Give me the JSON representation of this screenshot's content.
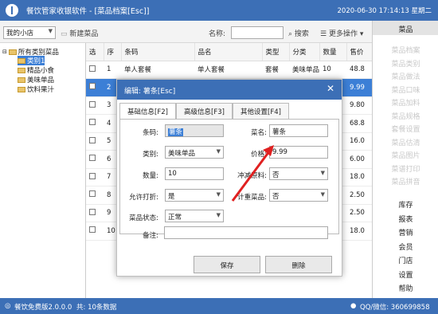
{
  "title": {
    "text": "餐饮管家收银软件 - [菜品档案[Esc]]",
    "datetime": "2020-06-30 17:14:13 星期二"
  },
  "toolbar": {
    "store": "我的小店",
    "add": "新建菜品",
    "name_label": "名称:",
    "search": "搜索",
    "more": "更多操作"
  },
  "tree": {
    "root": "所有类别菜品",
    "items": [
      "类别1",
      "精品小食",
      "美味单品",
      "饮料果汁"
    ]
  },
  "grid": {
    "headers": [
      "选",
      "序",
      "条码",
      "品名",
      "类型",
      "分类",
      "数量",
      "售价"
    ],
    "rows": [
      [
        "",
        "1",
        "单人套餐",
        "单人套餐",
        "套餐",
        "美味单品",
        "10",
        "48.8"
      ],
      [
        "",
        "2",
        "",
        "",
        "",
        "",
        "",
        "9.99"
      ],
      [
        "",
        "3",
        "",
        "",
        "",
        "",
        "",
        "9.80"
      ],
      [
        "",
        "4",
        "",
        "",
        "",
        "",
        "",
        "68.8"
      ],
      [
        "",
        "5",
        "",
        "",
        "",
        "",
        "",
        "16.0"
      ],
      [
        "",
        "6",
        "",
        "",
        "",
        "",
        "",
        "6.00"
      ],
      [
        "",
        "7",
        "",
        "",
        "",
        "",
        "",
        "18.0"
      ],
      [
        "",
        "8",
        "",
        "",
        "",
        "",
        "",
        "2.50"
      ],
      [
        "",
        "9",
        "",
        "",
        "",
        "",
        "",
        "2.50"
      ],
      [
        "",
        "10",
        "",
        "",
        "",
        "",
        "",
        "18.0"
      ]
    ]
  },
  "rightnav": {
    "top": "菜品",
    "faded": [
      "菜品档案",
      "菜品类别",
      "菜品做法",
      "菜品口味",
      "菜品加料",
      "菜品规格",
      "套餐设置",
      "菜品估清",
      "菜品图片",
      "菜谱打印",
      "菜品拼音"
    ],
    "items": [
      "库存",
      "报表",
      "营销",
      "会员",
      "门店",
      "设置",
      "帮助"
    ]
  },
  "status": {
    "version": "餐饮免费版2.0.0.0",
    "count": "共:  10条数据",
    "contact": "QQ/微信: 360699858"
  },
  "dialog": {
    "title": "编辑: 薯条[Esc]",
    "close": "✕",
    "tabs": [
      "基础信息[F2]",
      "高级信息[F3]",
      "其他设置[F4]"
    ],
    "fields": {
      "barcode_label": "条码:",
      "barcode": "薯条",
      "name_label": "菜名:",
      "name": "薯条",
      "category_label": "类别:",
      "category": "美味单品",
      "price_label": "价格:",
      "price": "9.99",
      "qty_label": "数量:",
      "qty": "10",
      "deduct_label": "冲减原料:",
      "deduct": "否",
      "discount_label": "允许打折:",
      "discount": "是",
      "weigh_label": "计重菜品:",
      "weigh": "否",
      "status_label": "菜品状态:",
      "status": "正常",
      "note_label": "备注:",
      "note": ""
    },
    "save": "保存",
    "delete": "删除"
  },
  "colors": {
    "titlebar": "#3c6fb6",
    "highlight": "#3c7fd6",
    "arrow": "#e02020"
  }
}
